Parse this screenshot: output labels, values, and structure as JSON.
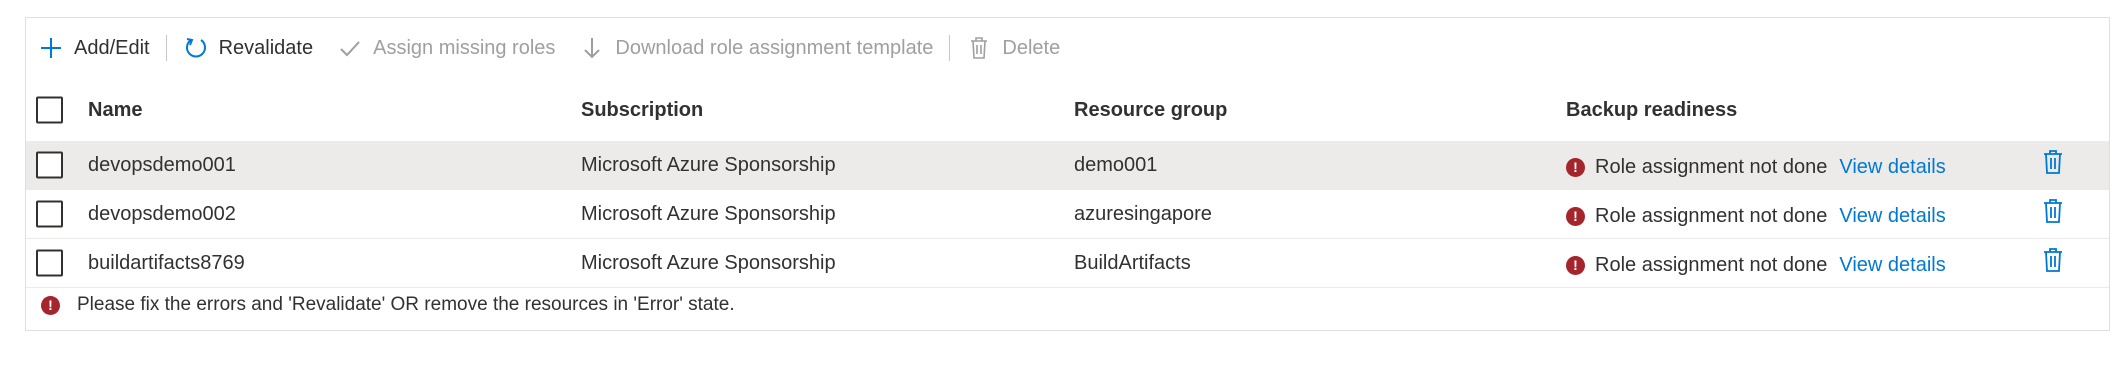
{
  "toolbar": {
    "add_edit": "Add/Edit",
    "revalidate": "Revalidate",
    "assign_missing_roles": "Assign missing roles",
    "download_template": "Download role assignment template",
    "delete": "Delete"
  },
  "table": {
    "headers": {
      "name": "Name",
      "subscription": "Subscription",
      "resource_group": "Resource group",
      "backup_readiness": "Backup readiness"
    },
    "rows": [
      {
        "name": "devopsdemo001",
        "subscription": "Microsoft Azure Sponsorship",
        "resource_group": "demo001",
        "status": "Role assignment not done",
        "link": "View details"
      },
      {
        "name": "devopsdemo002",
        "subscription": "Microsoft Azure Sponsorship",
        "resource_group": "azuresingapore",
        "status": "Role assignment not done",
        "link": "View details"
      },
      {
        "name": "buildartifacts8769",
        "subscription": "Microsoft Azure Sponsorship",
        "resource_group": "BuildArtifacts",
        "status": "Role assignment not done",
        "link": "View details"
      }
    ]
  },
  "footer": {
    "message": "Please fix the errors and 'Revalidate' OR remove the resources in 'Error' state."
  },
  "colors": {
    "accent": "#0078d4",
    "error": "#a4262c",
    "selected_row": "#edebe9"
  }
}
